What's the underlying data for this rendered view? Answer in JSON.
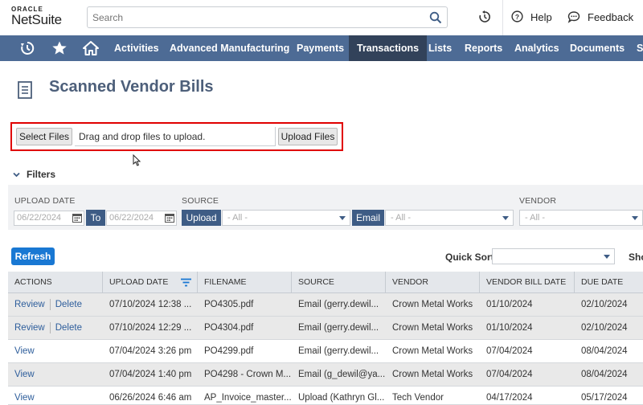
{
  "header": {
    "logo_top": "ORACLE",
    "logo_main": "NetSuite",
    "search_placeholder": "Search",
    "help": "Help",
    "feedback": "Feedback"
  },
  "nav": {
    "items": [
      "Activities",
      "Advanced Manufacturing",
      "Payments",
      "Transactions",
      "Lists",
      "Reports",
      "Analytics",
      "Documents",
      "Se"
    ],
    "active": "Transactions"
  },
  "page": {
    "title": "Scanned Vendor Bills"
  },
  "upload": {
    "select_files": "Select Files",
    "drop_hint": "Drag and drop files to upload.",
    "upload_files": "Upload Files"
  },
  "filters": {
    "toggle": "Filters",
    "upload_date_label": "UPLOAD DATE",
    "date_from": "06/22/2024",
    "to_label": "To",
    "date_to": "06/22/2024",
    "source_label": "SOURCE",
    "upload_tag": "Upload",
    "upload_select": "- All -",
    "email_tag": "Email",
    "email_select": "- All -",
    "vendor_label": "VENDOR",
    "vendor_select": "- All -"
  },
  "toolbar": {
    "refresh": "Refresh",
    "quick_sort": "Quick Sort",
    "show": "Sho"
  },
  "table": {
    "columns": [
      "ACTIONS",
      "UPLOAD DATE",
      "FILENAME",
      "SOURCE",
      "VENDOR",
      "VENDOR BILL DATE",
      "DUE DATE"
    ],
    "rows": [
      {
        "a1": "Review",
        "a2": "Delete",
        "upload_date": "07/10/2024 12:38 ...",
        "filename": "PO4305.pdf",
        "source": "Email (gerry.dewil...",
        "vendor": "Crown Metal Works",
        "bill_date": "01/10/2024",
        "due_date": "02/10/2024"
      },
      {
        "a1": "Review",
        "a2": "Delete",
        "upload_date": "07/10/2024 12:29 ...",
        "filename": "PO4304.pdf",
        "source": "Email (gerry.dewil...",
        "vendor": "Crown Metal Works",
        "bill_date": "01/10/2024",
        "due_date": "02/10/2024"
      },
      {
        "a1": "View",
        "a2": "",
        "upload_date": "07/04/2024 3:26 pm",
        "filename": "PO4299.pdf",
        "source": "Email (gerry.dewil...",
        "vendor": "Crown Metal Works",
        "bill_date": "07/04/2024",
        "due_date": "08/04/2024"
      },
      {
        "a1": "View",
        "a2": "",
        "upload_date": "07/04/2024 1:40 pm",
        "filename": "PO4298 - Crown M...",
        "source": "Email (g_dewil@ya...",
        "vendor": "Crown Metal Works",
        "bill_date": "07/04/2024",
        "due_date": "08/04/2024"
      },
      {
        "a1": "View",
        "a2": "",
        "upload_date": "06/26/2024 6:46 am",
        "filename": "AP_Invoice_master...",
        "source": "Upload (Kathryn Gl...",
        "vendor": "Tech Vendor",
        "bill_date": "04/17/2024",
        "due_date": "05/17/2024"
      }
    ]
  },
  "colors": {
    "nav_bg": "#4d6b95",
    "nav_active": "#32425a",
    "primary": "#1978d3",
    "highlight": "#e00000"
  }
}
